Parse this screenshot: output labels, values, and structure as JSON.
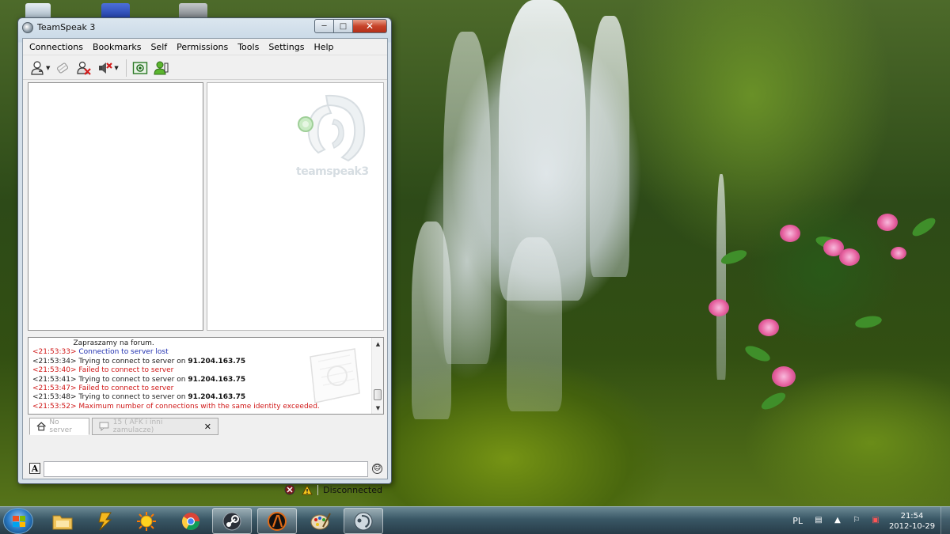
{
  "window": {
    "title": "TeamSpeak 3",
    "minimize_glyph": "─",
    "maximize_glyph": "□",
    "close_glyph": "✕"
  },
  "menu": [
    "Connections",
    "Bookmarks",
    "Self",
    "Permissions",
    "Tools",
    "Settings",
    "Help"
  ],
  "toolbar_icons": [
    "connect-icon",
    "disconnect-icon",
    "away-icon",
    "mute-icon",
    "capture-icon",
    "contacts-icon"
  ],
  "logo_text": "teamspeak3",
  "chat": {
    "lines": [
      {
        "ts": "",
        "text": "Zapraszamy na forum.",
        "tone": "dark",
        "bold": ""
      },
      {
        "ts": "<21:53:33>",
        "text": " Connection to server lost",
        "tone": "blue",
        "bold": ""
      },
      {
        "ts": "<21:53:34>",
        "text": " Trying to connect to server on ",
        "tone": "dark",
        "bold": "91.204.163.75"
      },
      {
        "ts": "<21:53:40>",
        "text": " Failed to connect to server",
        "tone": "red",
        "bold": ""
      },
      {
        "ts": "<21:53:41>",
        "text": " Trying to connect to server on ",
        "tone": "dark",
        "bold": "91.204.163.75"
      },
      {
        "ts": "<21:53:47>",
        "text": " Failed to connect to server",
        "tone": "red",
        "bold": ""
      },
      {
        "ts": "<21:53:48>",
        "text": " Trying to connect to server on ",
        "tone": "dark",
        "bold": "91.204.163.75"
      },
      {
        "ts": "<21:53:52>",
        "text": " Maximum number of connections with the same identity exceeded.",
        "tone": "red",
        "bold": ""
      }
    ],
    "scroll_up": "▲",
    "scroll_down": "▼"
  },
  "tabs": {
    "server_tab": "No server",
    "channel_tab": "15 ( AFK i inni zamulacze)",
    "close_glyph": "✕"
  },
  "input": {
    "format_label": "A",
    "value": "",
    "emoji_glyph": "☺"
  },
  "status": {
    "text": "Disconnected"
  },
  "taskbar": {
    "language": "PL",
    "time": "21:54",
    "date": "2012-10-29",
    "apps": [
      "explorer",
      "winamp",
      "sunny",
      "chrome",
      "steam",
      "half-life",
      "paint",
      "teamspeak"
    ]
  },
  "colors": {
    "chat_blue": "#1f2fb0",
    "chat_red": "#d01818",
    "window_frame": "#c8d8e6",
    "close_red": "#c7442a"
  }
}
